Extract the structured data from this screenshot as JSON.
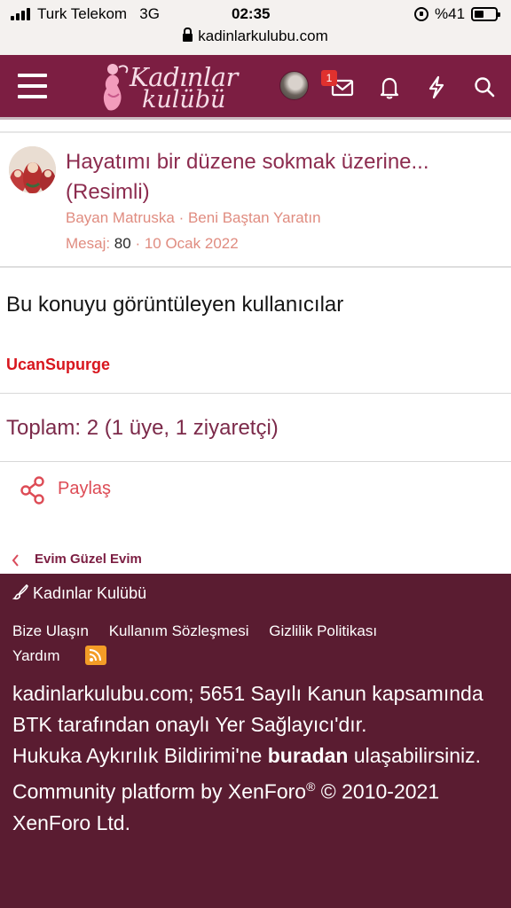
{
  "status_bar": {
    "carrier": "Turk Telekom",
    "network": "3G",
    "time": "02:35",
    "battery": "%41"
  },
  "browser": {
    "url": "kadinlarkulubu.com"
  },
  "header": {
    "logo_line1": "Kadınlar",
    "logo_line2": "kulübü",
    "inbox_badge": "1",
    "icons": [
      "menu-icon",
      "avatar",
      "mail-icon",
      "bell-icon",
      "bolt-icon",
      "search-icon"
    ]
  },
  "thread": {
    "title": "Hayatımı bir düzene sokmak üzerine... (Resimli)",
    "author": "Bayan Matruska",
    "forum": "Beni Baştan Yaratın",
    "meta_sep": " · ",
    "messages_label": "Mesaj: ",
    "messages_count": "80",
    "date": "10 Ocak 2022"
  },
  "viewers": {
    "title": "Bu konuyu görüntüleyen kullanıcılar",
    "users": [
      "UcanSupurge"
    ],
    "total": "Toplam: 2 (1 üye, 1 ziyaretçi)"
  },
  "share": {
    "label": "Paylaş"
  },
  "breadcrumb": {
    "label": "Evim Güzel Evim"
  },
  "footer": {
    "brand": "Kadınlar Kulübü",
    "links": [
      "Bize Ulaşın",
      "Kullanım Sözleşmesi",
      "Gizlilik Politikası",
      "Yardım"
    ],
    "legal_line1": "kadinlarkulubu.com; 5651 Sayılı Kanun kapsamında BTK tarafından onaylı Yer Sağlayıcı'dır.",
    "legal_line2_pre": "Hukuka Aykırılık Bildirimi'ne ",
    "legal_line2_link": "buradan",
    "legal_line2_post": " ulaşabilirsiniz.",
    "credit_pre": "Community platform by XenForo",
    "credit_reg": "®",
    "credit_post": " © 2010-2021 XenForo Ltd."
  },
  "colors": {
    "brand": "#7c1e42",
    "footer_bg": "#5a1c31",
    "accent_text": "#e08c80",
    "username": "#d8161e",
    "rss": "#f39c27"
  }
}
